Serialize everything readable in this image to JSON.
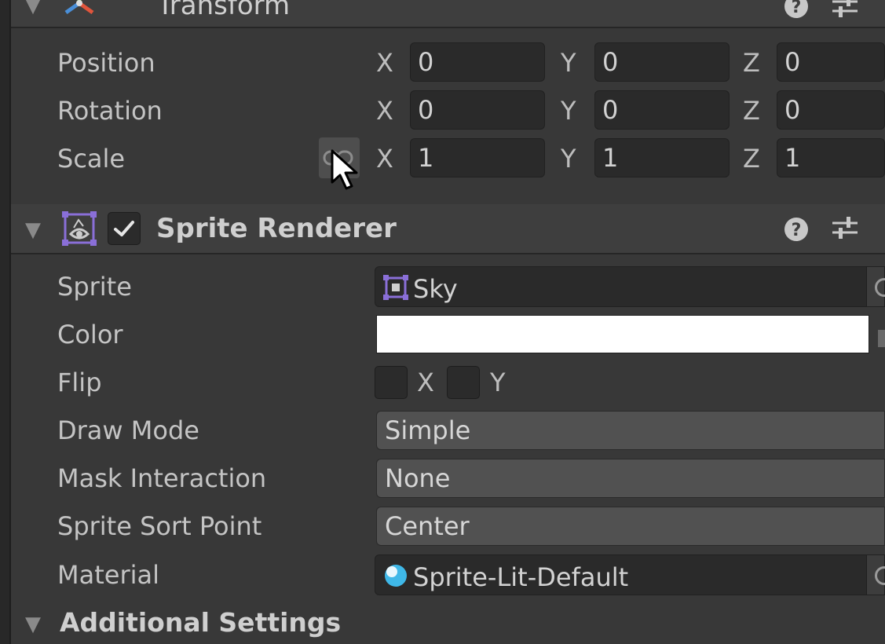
{
  "transform": {
    "title": "Transform",
    "rows": [
      {
        "label": "Position",
        "x": "0",
        "y": "0",
        "z": "0"
      },
      {
        "label": "Rotation",
        "x": "0",
        "y": "0",
        "z": "0"
      },
      {
        "label": "Scale",
        "x": "1",
        "y": "1",
        "z": "1"
      }
    ],
    "axis_labels": {
      "x": "X",
      "y": "Y",
      "z": "Z"
    }
  },
  "sprite_renderer": {
    "title": "Sprite Renderer",
    "enabled": true,
    "sprite": {
      "label": "Sprite",
      "value": "Sky"
    },
    "color": {
      "label": "Color",
      "value": "#ffffff"
    },
    "flip": {
      "label": "Flip",
      "x_label": "X",
      "y_label": "Y",
      "x_checked": false,
      "y_checked": false
    },
    "draw_mode": {
      "label": "Draw Mode",
      "value": "Simple"
    },
    "mask_interaction": {
      "label": "Mask Interaction",
      "value": "None"
    },
    "sprite_sort_point": {
      "label": "Sprite Sort Point",
      "value": "Center"
    },
    "material": {
      "label": "Material",
      "value": "Sprite-Lit-Default"
    }
  },
  "additional_settings": {
    "title": "Additional Settings"
  },
  "icons": {
    "help": "help-icon",
    "settings": "settings-sliders-icon",
    "foldout": "foldout-arrow-icon",
    "transform": "transform-axes-icon",
    "sprite_renderer": "sprite-renderer-icon",
    "sprite_asset": "sprite-asset-icon",
    "material_asset": "material-sphere-icon",
    "constrain_proportions": "link-icon",
    "cursor": "mouse-cursor-icon"
  }
}
